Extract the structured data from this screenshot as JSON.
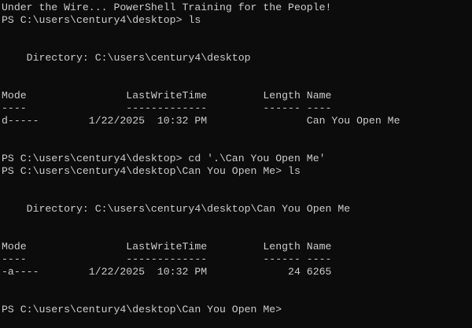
{
  "terminal": {
    "lines": [
      "Under the Wire... PowerShell Training for the People!",
      "PS C:\\users\\century4\\desktop> ls",
      "",
      "",
      "    Directory: C:\\users\\century4\\desktop",
      "",
      "",
      "Mode                LastWriteTime         Length Name",
      "----                -------------         ------ ----",
      "d-----        1/22/2025  10:32 PM                Can You Open Me",
      "",
      "",
      "PS C:\\users\\century4\\desktop> cd '.\\Can You Open Me'",
      "PS C:\\users\\century4\\desktop\\Can You Open Me> ls",
      "",
      "",
      "    Directory: C:\\users\\century4\\desktop\\Can You Open Me",
      "",
      "",
      "Mode                LastWriteTime         Length Name",
      "----                -------------         ------ ----",
      "-a----        1/22/2025  10:32 PM             24 6265",
      "",
      "",
      "PS C:\\users\\century4\\desktop\\Can You Open Me>"
    ]
  }
}
